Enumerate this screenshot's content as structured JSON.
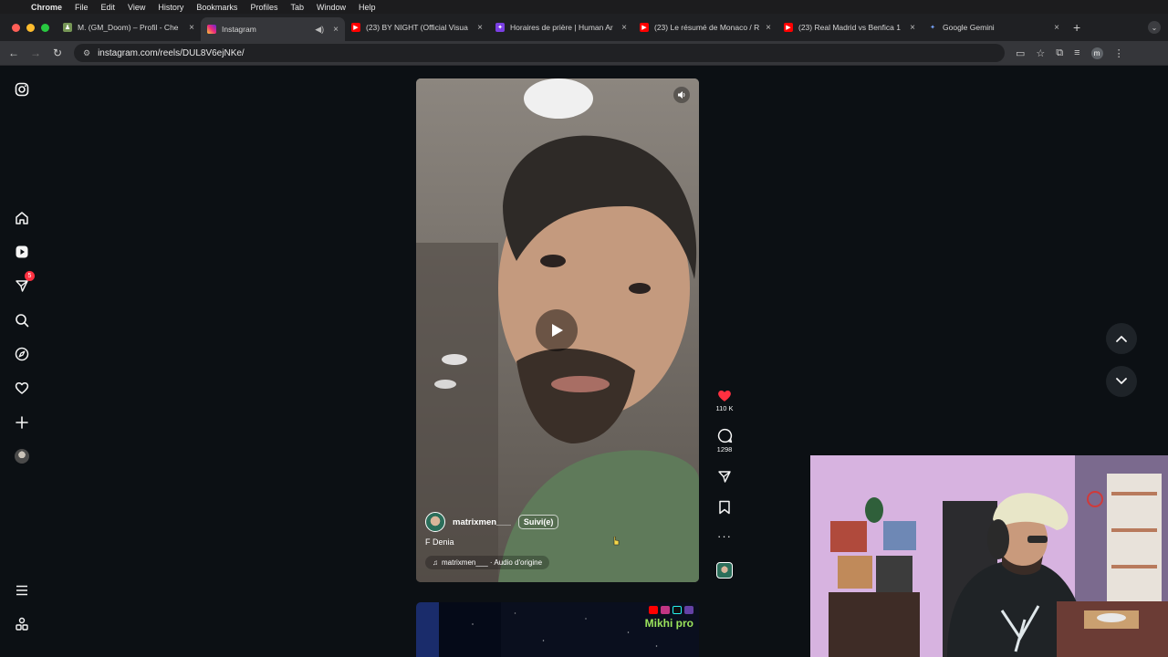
{
  "menubar": {
    "app": "Chrome",
    "items": [
      "File",
      "Edit",
      "View",
      "History",
      "Bookmarks",
      "Profiles",
      "Tab",
      "Window",
      "Help"
    ]
  },
  "tabs": [
    {
      "title": "M. (GM_Doom) – Profil - Che",
      "favicon": "chess-icon",
      "active": false
    },
    {
      "title": "Instagram",
      "favicon": "instagram-icon",
      "active": true,
      "audio": true
    },
    {
      "title": "(23) BY NIGHT (Official Visua",
      "favicon": "youtube-icon",
      "active": false
    },
    {
      "title": "Horaires de prière | Human Ar",
      "favicon": "app-icon",
      "active": false
    },
    {
      "title": "(23) Le résumé de Monaco / R",
      "favicon": "youtube-icon",
      "active": false
    },
    {
      "title": "(23) Real Madrid vs Benfica 1",
      "favicon": "youtube-icon",
      "active": false
    },
    {
      "title": "Google Gemini",
      "favicon": "gemini-icon",
      "active": false
    }
  ],
  "address": {
    "url": "instagram.com/reels/DUL8V6ejNKe/"
  },
  "sidebar": {
    "notifications_badge": "5"
  },
  "reel": {
    "username": "matrixmen___",
    "follow_label": "Suivi(e)",
    "caption": "F Denia",
    "audio": "matrixmen___ · Audio d'origine",
    "likes": "110 K",
    "comments": "1298"
  },
  "next_reel": {
    "brand": "Mikhi pro"
  },
  "colors": {
    "background": "#0c1014",
    "like": "#ff3040"
  }
}
